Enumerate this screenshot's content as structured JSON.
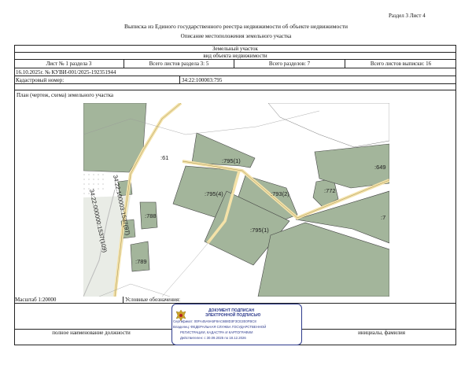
{
  "header": {
    "section_sheet": "Раздел 3   Лист 4",
    "title": "Выписка из Единого государственного реестра недвижимости об объекте недвижимости",
    "subtitle": "Описание местоположения земельного участка"
  },
  "table": {
    "object_type": "Земельный участок",
    "object_kind_label": "вид объекта недвижимости",
    "sheet_no": "Лист № 1 раздела 3",
    "sheets_in_section": "Всего листов раздела 3: 5",
    "sections_total": "Всего разделов: 7",
    "sheets_total": "Всего листов выписки: 16",
    "doc_number": "16.10.2025г. № КУВИ-001/2025-192351944",
    "cadastral_label": "Кадастровый номер:",
    "cadastral_value": "34:22:100003:795",
    "plan_label": "План (чертеж, схема) земельного участка"
  },
  "map": {
    "labels": {
      "p61": ":61",
      "p795_1_top": ":795(1)",
      "p795_4": ":795(4)",
      "p793_2": ":793(2)",
      "p772": ":772",
      "p649": ":649",
      "p795_1": ":795(1)",
      "p788": ":788",
      "p789": ":789",
      "road1": "34:22:100003:1537(97)",
      "road2": "34:22:000000:1537(109)",
      "p_right": ":7"
    },
    "colors": {
      "parcel": "#a3b59b",
      "road": "#f4e2a8",
      "outline": "#444444"
    }
  },
  "footer": {
    "scale": "Масштаб 1:20000",
    "legend_label": "Условные обозначения:",
    "position_label": "полное наименование должности",
    "initials_label": "инициалы, фамилия"
  },
  "signature": {
    "line1": "ДОКУМЕНТ ПОДПИСАН",
    "line2": "ЭЛЕКТРОННОЙ ПОДПИСЬЮ",
    "line3": "Сертификат: 00FA45A9A5F8AC6B8D3F3CE2E0FBC8",
    "line4": "Владелец: ФЕДЕРАЛЬНАЯ СЛУЖБА ГОСУДАРСТВЕННОЙ",
    "line5": "РЕГИСТРАЦИИ, КАДАСТРА И КАРТОГРАФИИ",
    "line6": "Действителен: с 30.09.2025 по 18.12.2026",
    "emblem": "eagle-emblem"
  }
}
